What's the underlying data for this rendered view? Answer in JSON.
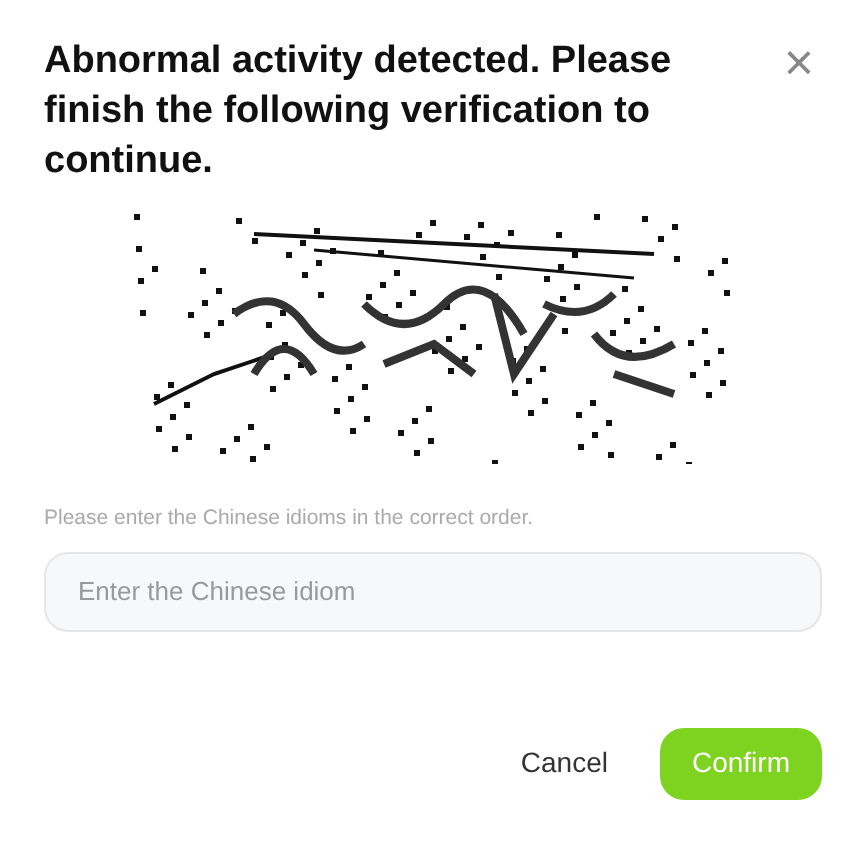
{
  "dialog": {
    "title": "Abnormal activity detected. Please finish the following verification to continue.",
    "close": "×"
  },
  "hint": "Please enter the Chinese idioms in the correct order.",
  "answer": {
    "placeholder": "Enter the Chinese idiom"
  },
  "buttons": [
    {
      "label": "Cancel",
      "kind": "text"
    },
    {
      "label": "Confirm",
      "kind": "primary"
    }
  ]
}
